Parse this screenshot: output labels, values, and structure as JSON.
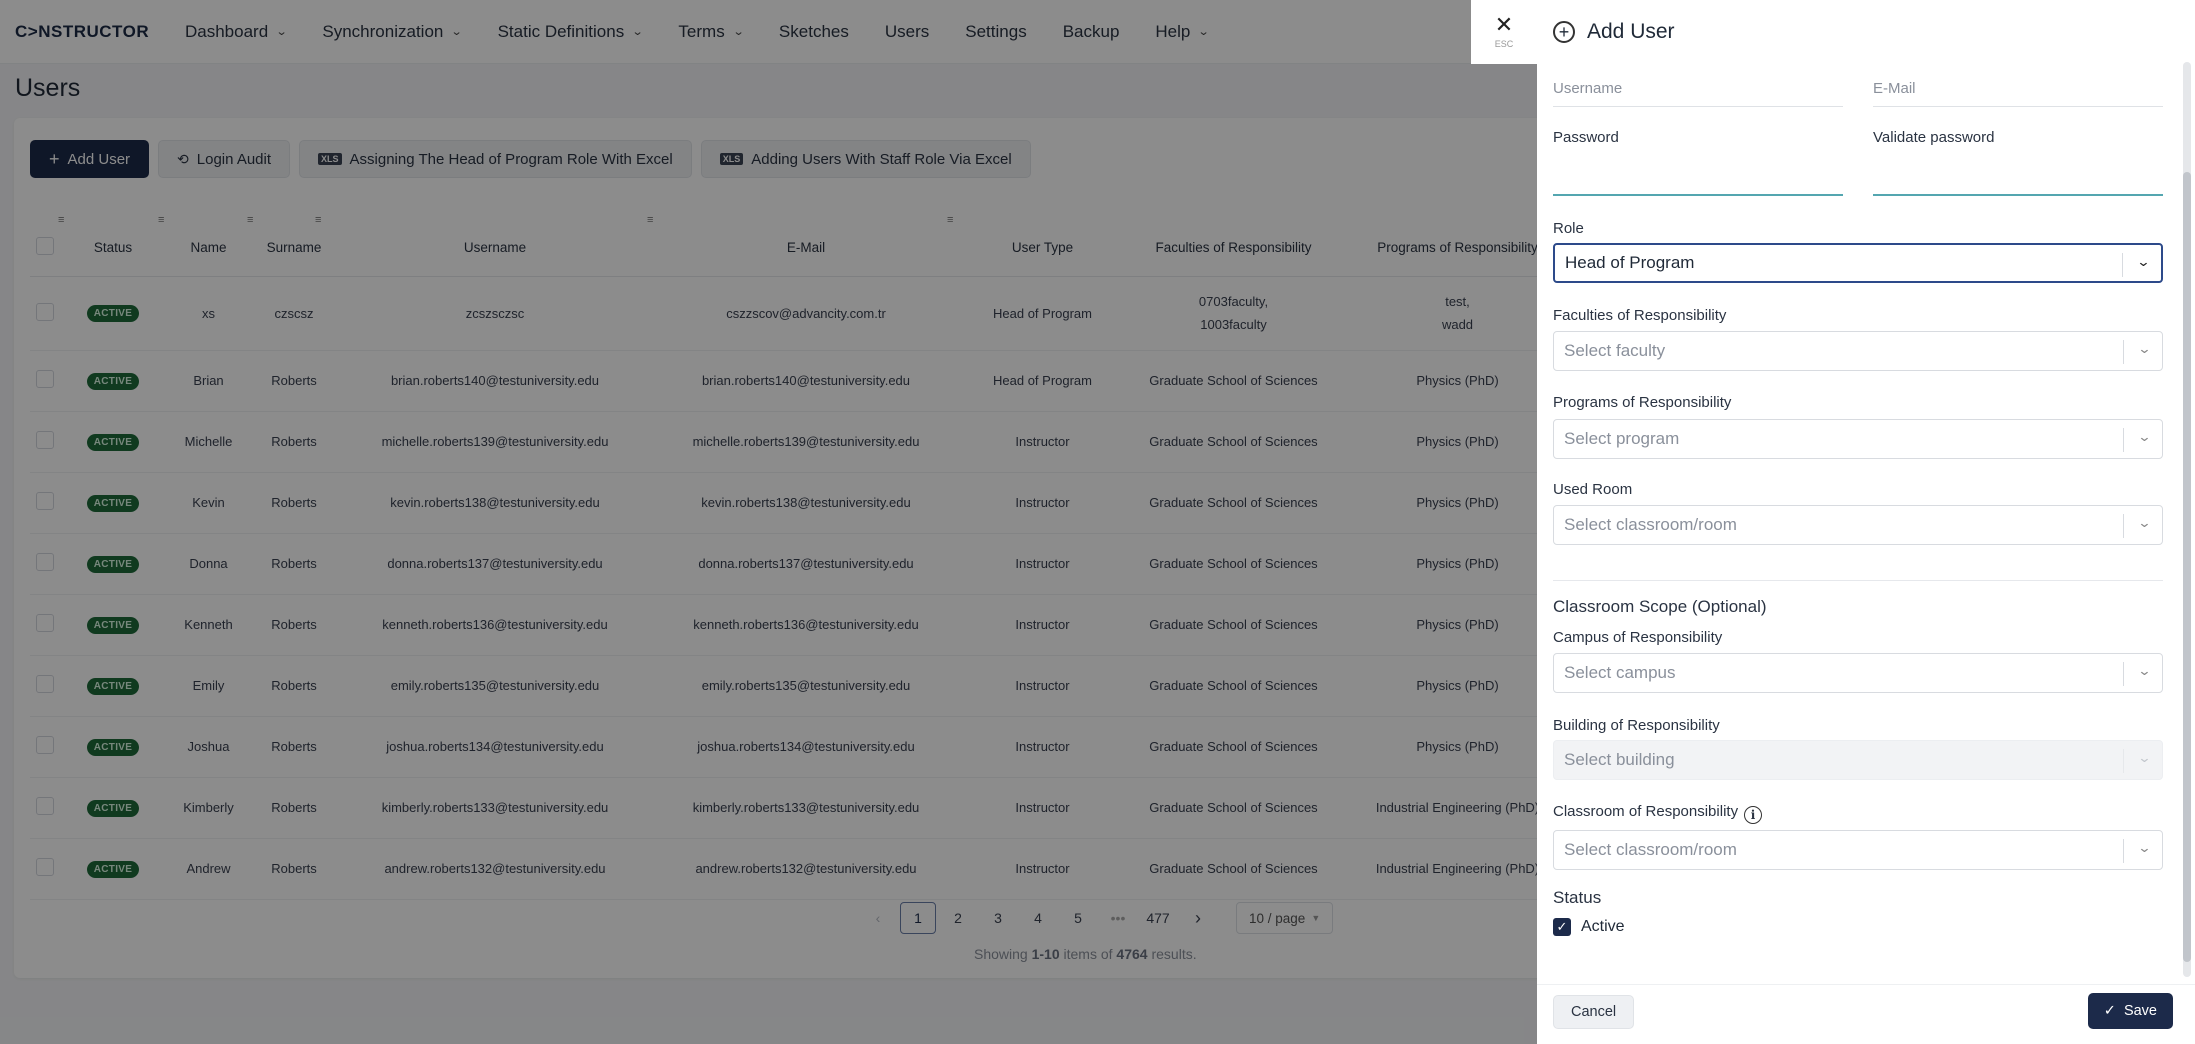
{
  "app": {
    "logo": "C>NSTRUCTOR"
  },
  "nav": [
    {
      "label": "Dashboard",
      "dropdown": true
    },
    {
      "label": "Synchronization",
      "dropdown": true
    },
    {
      "label": "Static Definitions",
      "dropdown": true
    },
    {
      "label": "Terms",
      "dropdown": true
    },
    {
      "label": "Sketches",
      "dropdown": false
    },
    {
      "label": "Users",
      "dropdown": false
    },
    {
      "label": "Settings",
      "dropdown": false
    },
    {
      "label": "Backup",
      "dropdown": false
    },
    {
      "label": "Help",
      "dropdown": true
    }
  ],
  "page": {
    "title": "Users"
  },
  "toolbar": {
    "add_user": "Add User",
    "login_audit": "Login Audit",
    "assign_head": "Assigning The Head of Program Role With Excel",
    "add_staff": "Adding Users With Staff Role Via Excel",
    "xls_tag": "XLS"
  },
  "table": {
    "columns": [
      "Status",
      "Name",
      "Surname",
      "Username",
      "E-Mail",
      "User Type",
      "Faculties of Responsibility",
      "Programs of Responsibility"
    ],
    "rows": [
      {
        "status": "ACTIVE",
        "name": "xs",
        "surname": "czscsz",
        "username": "zcszsczsc",
        "email": "cszzscov@advancity.com.tr",
        "type": "Head of Program",
        "faculty": "0703faculty,\n1003faculty",
        "program": "test,\nwadd"
      },
      {
        "status": "ACTIVE",
        "name": "Brian",
        "surname": "Roberts",
        "username": "brian.roberts140@testuniversity.edu",
        "email": "brian.roberts140@testuniversity.edu",
        "type": "Head of Program",
        "faculty": "Graduate School of Sciences",
        "program": "Physics (PhD)"
      },
      {
        "status": "ACTIVE",
        "name": "Michelle",
        "surname": "Roberts",
        "username": "michelle.roberts139@testuniversity.edu",
        "email": "michelle.roberts139@testuniversity.edu",
        "type": "Instructor",
        "faculty": "Graduate School of Sciences",
        "program": "Physics (PhD)"
      },
      {
        "status": "ACTIVE",
        "name": "Kevin",
        "surname": "Roberts",
        "username": "kevin.roberts138@testuniversity.edu",
        "email": "kevin.roberts138@testuniversity.edu",
        "type": "Instructor",
        "faculty": "Graduate School of Sciences",
        "program": "Physics (PhD)"
      },
      {
        "status": "ACTIVE",
        "name": "Donna",
        "surname": "Roberts",
        "username": "donna.roberts137@testuniversity.edu",
        "email": "donna.roberts137@testuniversity.edu",
        "type": "Instructor",
        "faculty": "Graduate School of Sciences",
        "program": "Physics (PhD)"
      },
      {
        "status": "ACTIVE",
        "name": "Kenneth",
        "surname": "Roberts",
        "username": "kenneth.roberts136@testuniversity.edu",
        "email": "kenneth.roberts136@testuniversity.edu",
        "type": "Instructor",
        "faculty": "Graduate School of Sciences",
        "program": "Physics (PhD)"
      },
      {
        "status": "ACTIVE",
        "name": "Emily",
        "surname": "Roberts",
        "username": "emily.roberts135@testuniversity.edu",
        "email": "emily.roberts135@testuniversity.edu",
        "type": "Instructor",
        "faculty": "Graduate School of Sciences",
        "program": "Physics (PhD)"
      },
      {
        "status": "ACTIVE",
        "name": "Joshua",
        "surname": "Roberts",
        "username": "joshua.roberts134@testuniversity.edu",
        "email": "joshua.roberts134@testuniversity.edu",
        "type": "Instructor",
        "faculty": "Graduate School of Sciences",
        "program": "Physics (PhD)"
      },
      {
        "status": "ACTIVE",
        "name": "Kimberly",
        "surname": "Roberts",
        "username": "kimberly.roberts133@testuniversity.edu",
        "email": "kimberly.roberts133@testuniversity.edu",
        "type": "Instructor",
        "faculty": "Graduate School of Sciences",
        "program": "Industrial Engineering (PhD)"
      },
      {
        "status": "ACTIVE",
        "name": "Andrew",
        "surname": "Roberts",
        "username": "andrew.roberts132@testuniversity.edu",
        "email": "andrew.roberts132@testuniversity.edu",
        "type": "Instructor",
        "faculty": "Graduate School of Sciences",
        "program": "Industrial Engineering (PhD)"
      }
    ]
  },
  "pagination": {
    "pages": [
      "1",
      "2",
      "3",
      "4",
      "5"
    ],
    "ellipsis": "•••",
    "last": "477",
    "page_size": "10 / page",
    "summary_prefix": "Showing ",
    "summary_range": "1-10",
    "summary_mid": " items of ",
    "summary_total": "4764",
    "summary_suffix": " results."
  },
  "drawer": {
    "close_hint": "ESC",
    "title": "Add User",
    "username_placeholder": "Username",
    "email_placeholder": "E-Mail",
    "password_label": "Password",
    "validate_label": "Validate password",
    "role_label": "Role",
    "role_value": "Head of Program",
    "faculties_label": "Faculties of Responsibility",
    "faculties_placeholder": "Select faculty",
    "programs_label": "Programs of Responsibility",
    "programs_placeholder": "Select program",
    "room_label": "Used Room",
    "room_placeholder": "Select classroom/room",
    "scope_title": "Classroom Scope (Optional)",
    "campus_label": "Campus of Responsibility",
    "campus_placeholder": "Select campus",
    "building_label": "Building of Responsibility",
    "building_placeholder": "Select building",
    "classroom_label": "Classroom of Responsibility",
    "classroom_placeholder": "Select classroom/room",
    "status_title": "Status",
    "active_label": "Active",
    "cancel": "Cancel",
    "save": "Save"
  },
  "colors": {
    "primary": "#1c2a4a",
    "active_badge": "#1e6b3a",
    "focus_border": "#2d4a8a",
    "password_underline": "#54a6b0"
  }
}
